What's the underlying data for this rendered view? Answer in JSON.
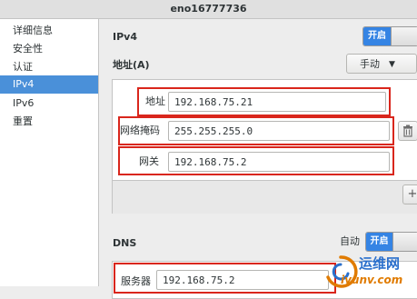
{
  "window": {
    "title": "eno16777736"
  },
  "sidebar": {
    "items": [
      {
        "label": "详细信息"
      },
      {
        "label": "安全性"
      },
      {
        "label": "认证"
      },
      {
        "label": "IPv4"
      },
      {
        "label": "IPv6"
      },
      {
        "label": "重置"
      }
    ],
    "selected_index": 3
  },
  "ipv4": {
    "heading": "IPv4",
    "toggle_label": "开启",
    "address_section_label": "地址(A)",
    "method_value": "手动",
    "address_label": "地址",
    "address_value": "192.168.75.21",
    "netmask_label": "网络掩码",
    "netmask_value": "255.255.255.0",
    "gateway_label": "网关",
    "gateway_value": "192.168.75.2",
    "add_symbol": "+"
  },
  "dns": {
    "heading": "DNS",
    "auto_label": "自动",
    "toggle_label": "开启",
    "server_label": "服务器",
    "server_value": "192.168.75.2"
  },
  "watermark": {
    "line1": "运维网",
    "line2": "iyunv.com"
  },
  "colors": {
    "accent": "#3584e4",
    "selection": "#4a90d9",
    "highlight_box": "#d9261c"
  }
}
